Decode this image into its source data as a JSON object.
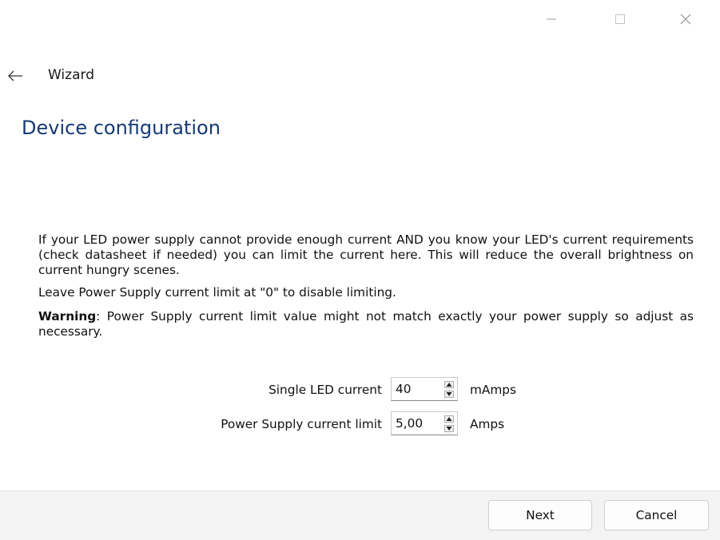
{
  "window": {
    "controls": [
      "minimize-icon",
      "maximize-icon",
      "close-icon"
    ]
  },
  "header": {
    "back_icon": "arrow-left-icon",
    "wizard_label": "Wizard",
    "page_title": "Device configuration"
  },
  "body": {
    "paragraph1": "If your LED power supply cannot provide enough current AND you know your LED's current requirements (check datasheet if needed) you can limit the current here. This will reduce the overall brightness on current hungry scenes.",
    "paragraph2": "Leave Power Supply current limit at \"0\" to disable limiting.",
    "warning_label": "Warning",
    "warning_text": ": Power Supply current limit value might not match exactly your power supply so adjust as necessary."
  },
  "fields": {
    "single_led": {
      "label": "Single LED current",
      "value": "40",
      "unit": "mAmps"
    },
    "psu_limit": {
      "label": "Power Supply current limit",
      "value": "5,00",
      "unit": "Amps"
    }
  },
  "footer": {
    "next_label": "Next",
    "cancel_label": "Cancel"
  },
  "colors": {
    "title": "#163a74",
    "footer_bg": "#f3f3f3"
  }
}
